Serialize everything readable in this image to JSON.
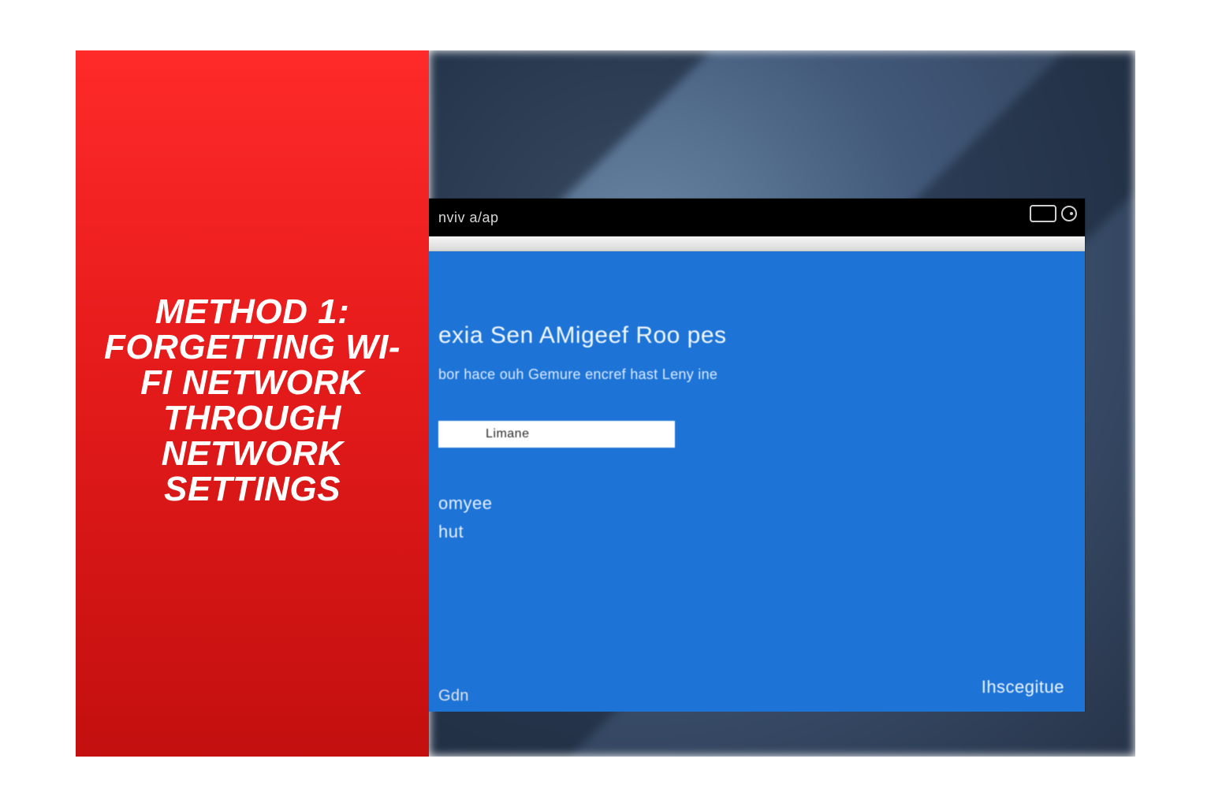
{
  "left": {
    "headline": "METHOD 1: FORGETTING WI-FI NETWORK THROUGH NETWORK SETTINGS"
  },
  "window": {
    "title": "nviv a/ap",
    "heading": "exia Sen AMigeef Roo pes",
    "subtitle": "bor hace ouh Gemure encref hast Leny ine",
    "input_text": "Limane",
    "line1": "omyee",
    "line2": "hut",
    "corner_link": "Ihscegitue"
  },
  "below_text": "Gdn"
}
